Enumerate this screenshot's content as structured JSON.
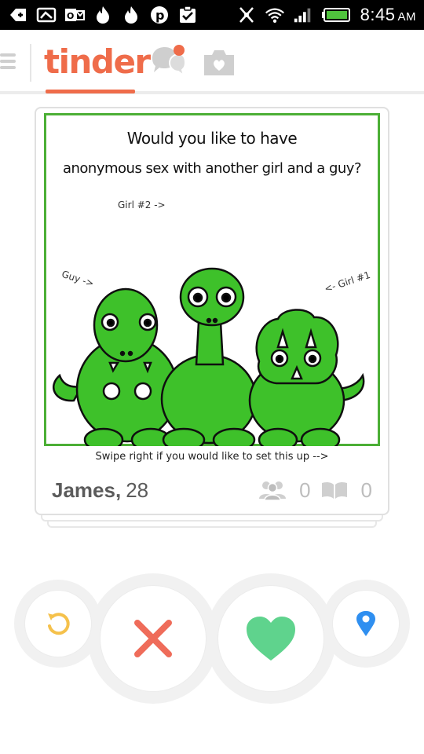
{
  "status_bar": {
    "time": "8:45",
    "ampm": "AM",
    "icons": [
      "add-icon",
      "picture-icon",
      "outlook-icon",
      "flame-icon",
      "flame-icon",
      "pinterest-icon",
      "task-icon",
      "mute-icon",
      "wifi-icon",
      "signal-icon",
      "battery-icon"
    ]
  },
  "app_bar": {
    "logo": "tinder",
    "brand_color": "#ef6c4a",
    "icons": [
      "menu-icon",
      "chat-icon",
      "camera-icon"
    ]
  },
  "card": {
    "name": "James,",
    "age": "28",
    "shared_friends": "0",
    "shared_interests": "0",
    "photo": {
      "title_line1": "Would you like to have",
      "title_line2": "anonymous sex with another girl and a guy?",
      "label_girl2": "Girl #2 ->",
      "label_guy": "Guy ->",
      "label_girl1": "<- Girl #1",
      "caption": "Swipe right if you would like to set this up -->"
    }
  },
  "actions": {
    "undo_icon": "undo-icon",
    "nope_icon": "x-icon",
    "like_icon": "heart-icon",
    "location_icon": "location-pin-icon",
    "nope_color": "#ef6c5a",
    "like_color": "#5fd38d",
    "undo_color": "#f5c14b",
    "location_color": "#2f8ff0"
  }
}
